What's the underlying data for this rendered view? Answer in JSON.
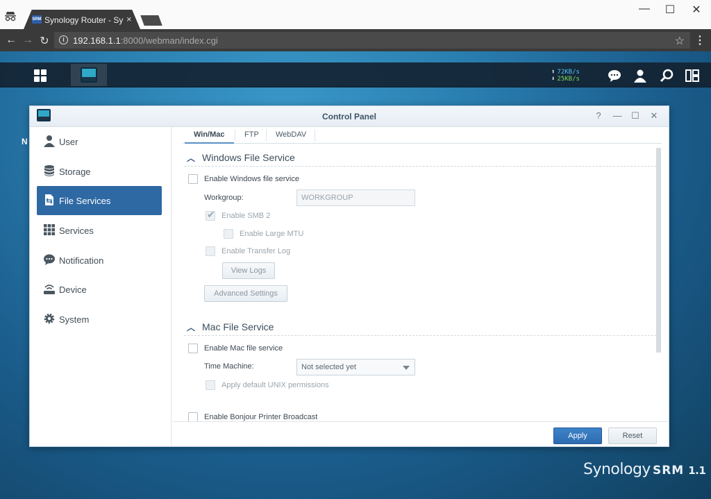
{
  "browser": {
    "tab_title": "Synology Router - Synology",
    "favicon_text": "SRM",
    "tab_close": "×",
    "url_host": "192.168.1.1",
    "url_path": ":8000/webman/index.cgi",
    "window_controls": {
      "minimize": "—",
      "maximize": "☐",
      "close": "✕"
    },
    "nav": {
      "back": "←",
      "forward": "→",
      "reload": "↻",
      "star": "☆",
      "menu": "⋮"
    }
  },
  "taskbar": {
    "upload_speed": "72KB/s",
    "download_speed": "25KB/s",
    "icons": [
      "main-menu-icon",
      "control-panel-icon",
      "chat-icon",
      "user-icon",
      "search-icon",
      "widgets-icon"
    ]
  },
  "desktop": {
    "partial_label": "N",
    "brand": "Synology",
    "brand_product": "SRM",
    "brand_version": "1.1"
  },
  "window": {
    "title": "Control Panel",
    "controls": {
      "help": "?",
      "minimize": "—",
      "maximize": "☐",
      "close": "✕"
    }
  },
  "sidebar": {
    "items": [
      {
        "label": "User",
        "icon": "user-icon",
        "active": false
      },
      {
        "label": "Storage",
        "icon": "storage-icon",
        "active": false
      },
      {
        "label": "File Services",
        "icon": "file-services-icon",
        "active": true
      },
      {
        "label": "Services",
        "icon": "services-icon",
        "active": false
      },
      {
        "label": "Notification",
        "icon": "notification-icon",
        "active": false
      },
      {
        "label": "Device",
        "icon": "device-icon",
        "active": false
      },
      {
        "label": "System",
        "icon": "system-icon",
        "active": false
      }
    ]
  },
  "tabs": [
    {
      "label": "Win/Mac",
      "active": true
    },
    {
      "label": "FTP",
      "active": false
    },
    {
      "label": "WebDAV",
      "active": false
    }
  ],
  "windows_section": {
    "title": "Windows File Service",
    "enable_label": "Enable Windows file service",
    "enable_checked": false,
    "workgroup_label": "Workgroup:",
    "workgroup_value": "WORKGROUP",
    "smb2_label": "Enable SMB 2",
    "smb2_checked": true,
    "large_mtu_label": "Enable Large MTU",
    "transfer_log_label": "Enable Transfer Log",
    "view_logs_label": "View Logs",
    "advanced_label": "Advanced Settings"
  },
  "mac_section": {
    "title": "Mac File Service",
    "enable_label": "Enable Mac file service",
    "time_machine_label": "Time Machine:",
    "time_machine_value": "Not selected yet",
    "unix_perm_label": "Apply default UNIX permissions",
    "bonjour_label": "Enable Bonjour Printer Broadcast"
  },
  "footer": {
    "apply_label": "Apply",
    "reset_label": "Reset"
  },
  "colors": {
    "accent": "#2e69a4",
    "apply_button": "#3576bd",
    "upload_speed": "#4fc3f7",
    "download_speed": "#7ed957"
  }
}
